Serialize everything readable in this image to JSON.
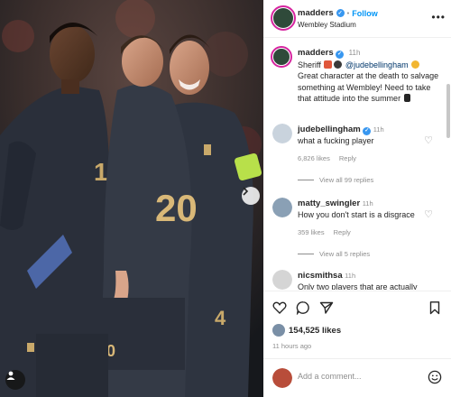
{
  "post": {
    "username": "madders",
    "follow_label": "Follow",
    "location": "Wembley Stadium",
    "menu_glyph": "•••",
    "caption": {
      "username": "madders",
      "time": "11h",
      "text_before": "Sheriff",
      "mention": "@judebellingham",
      "text_after": "Great character at the death to salvage something at Wembley! Need to take that attitude into the summer"
    }
  },
  "comments": [
    {
      "username": "judebellingham",
      "verified": true,
      "time": "11h",
      "text": "what a fucking player",
      "likes": "6,826 likes",
      "reply_label": "Reply",
      "view_replies": "View all 99 replies",
      "avatar_color": "#c9d3dd"
    },
    {
      "username": "matty_swingler",
      "verified": false,
      "time": "11h",
      "text": "How you don't start is a disgrace",
      "likes": "359 likes",
      "reply_label": "Reply",
      "view_replies": "View all 5 replies",
      "avatar_color": "#8aa0b5"
    },
    {
      "username": "nicsmithsa",
      "verified": false,
      "time": "11h",
      "text": "Only two players that are actually",
      "avatar_color": "#d5d5d5"
    }
  ],
  "actions": {
    "likes": "154,525 likes",
    "posted": "11 hours ago"
  },
  "add_comment": {
    "placeholder": "Add a comment..."
  },
  "photo": {
    "shirt_numbers": [
      "10",
      "20",
      "4"
    ]
  },
  "colors": {
    "accent_blue": "#0095f6",
    "verified_blue": "#3897f0",
    "mention_blue": "#00376b",
    "muted": "#8e8e8e",
    "kit_navy": "#2a2f3a"
  },
  "icons": [
    "heart-icon",
    "comment-icon",
    "share-icon",
    "bookmark-icon",
    "smile-icon",
    "chevron-right-icon",
    "person-tag-icon",
    "verified-icon"
  ]
}
